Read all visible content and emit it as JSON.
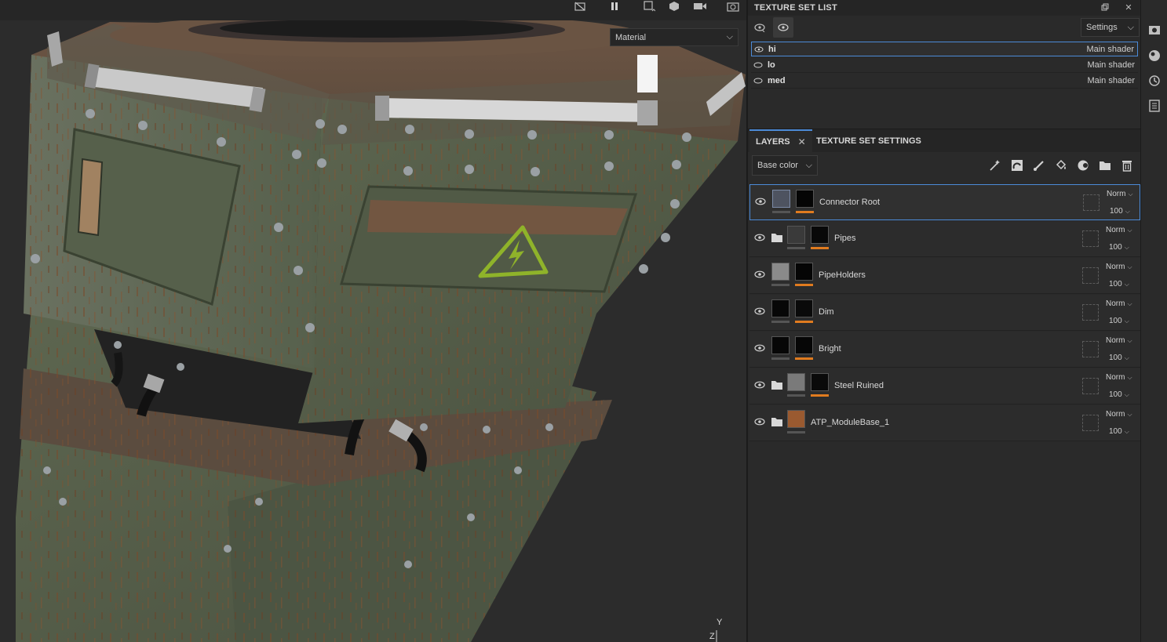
{
  "viewport": {
    "material_mode": "Material",
    "axis": {
      "y": "Y",
      "z": "Z"
    },
    "toolbar_icons": [
      "hide-icon",
      "pause-icon",
      "camera-frame-icon",
      "cube-icon",
      "video-camera-icon",
      "screenshot-icon"
    ]
  },
  "texture_set_list": {
    "title": "TEXTURE SET LIST",
    "settings_label": "Settings",
    "items": [
      {
        "name": "hi",
        "shader": "Main shader"
      },
      {
        "name": "lo",
        "shader": "Main shader"
      },
      {
        "name": "med",
        "shader": "Main shader"
      }
    ]
  },
  "tabs": {
    "layers": "LAYERS",
    "close": "✕",
    "texture_set_settings": "TEXTURE SET SETTINGS"
  },
  "layers": {
    "channel": "Base color",
    "items": [
      {
        "name": "Connector Root",
        "blend": "Norm",
        "opacity": "100"
      },
      {
        "name": "Pipes",
        "blend": "Norm",
        "opacity": "100"
      },
      {
        "name": "PipeHolders",
        "blend": "Norm",
        "opacity": "100"
      },
      {
        "name": "Dim",
        "blend": "Norm",
        "opacity": "100"
      },
      {
        "name": "Bright",
        "blend": "Norm",
        "opacity": "100"
      },
      {
        "name": "Steel Ruined",
        "blend": "Norm",
        "opacity": "100"
      },
      {
        "name": "ATP_ModuleBase_1",
        "blend": "Norm",
        "opacity": "100"
      }
    ]
  },
  "colors": {
    "accent": "#4c8bd8",
    "mask_bar": "#e07b1f",
    "hazard": "#8fb32a"
  }
}
